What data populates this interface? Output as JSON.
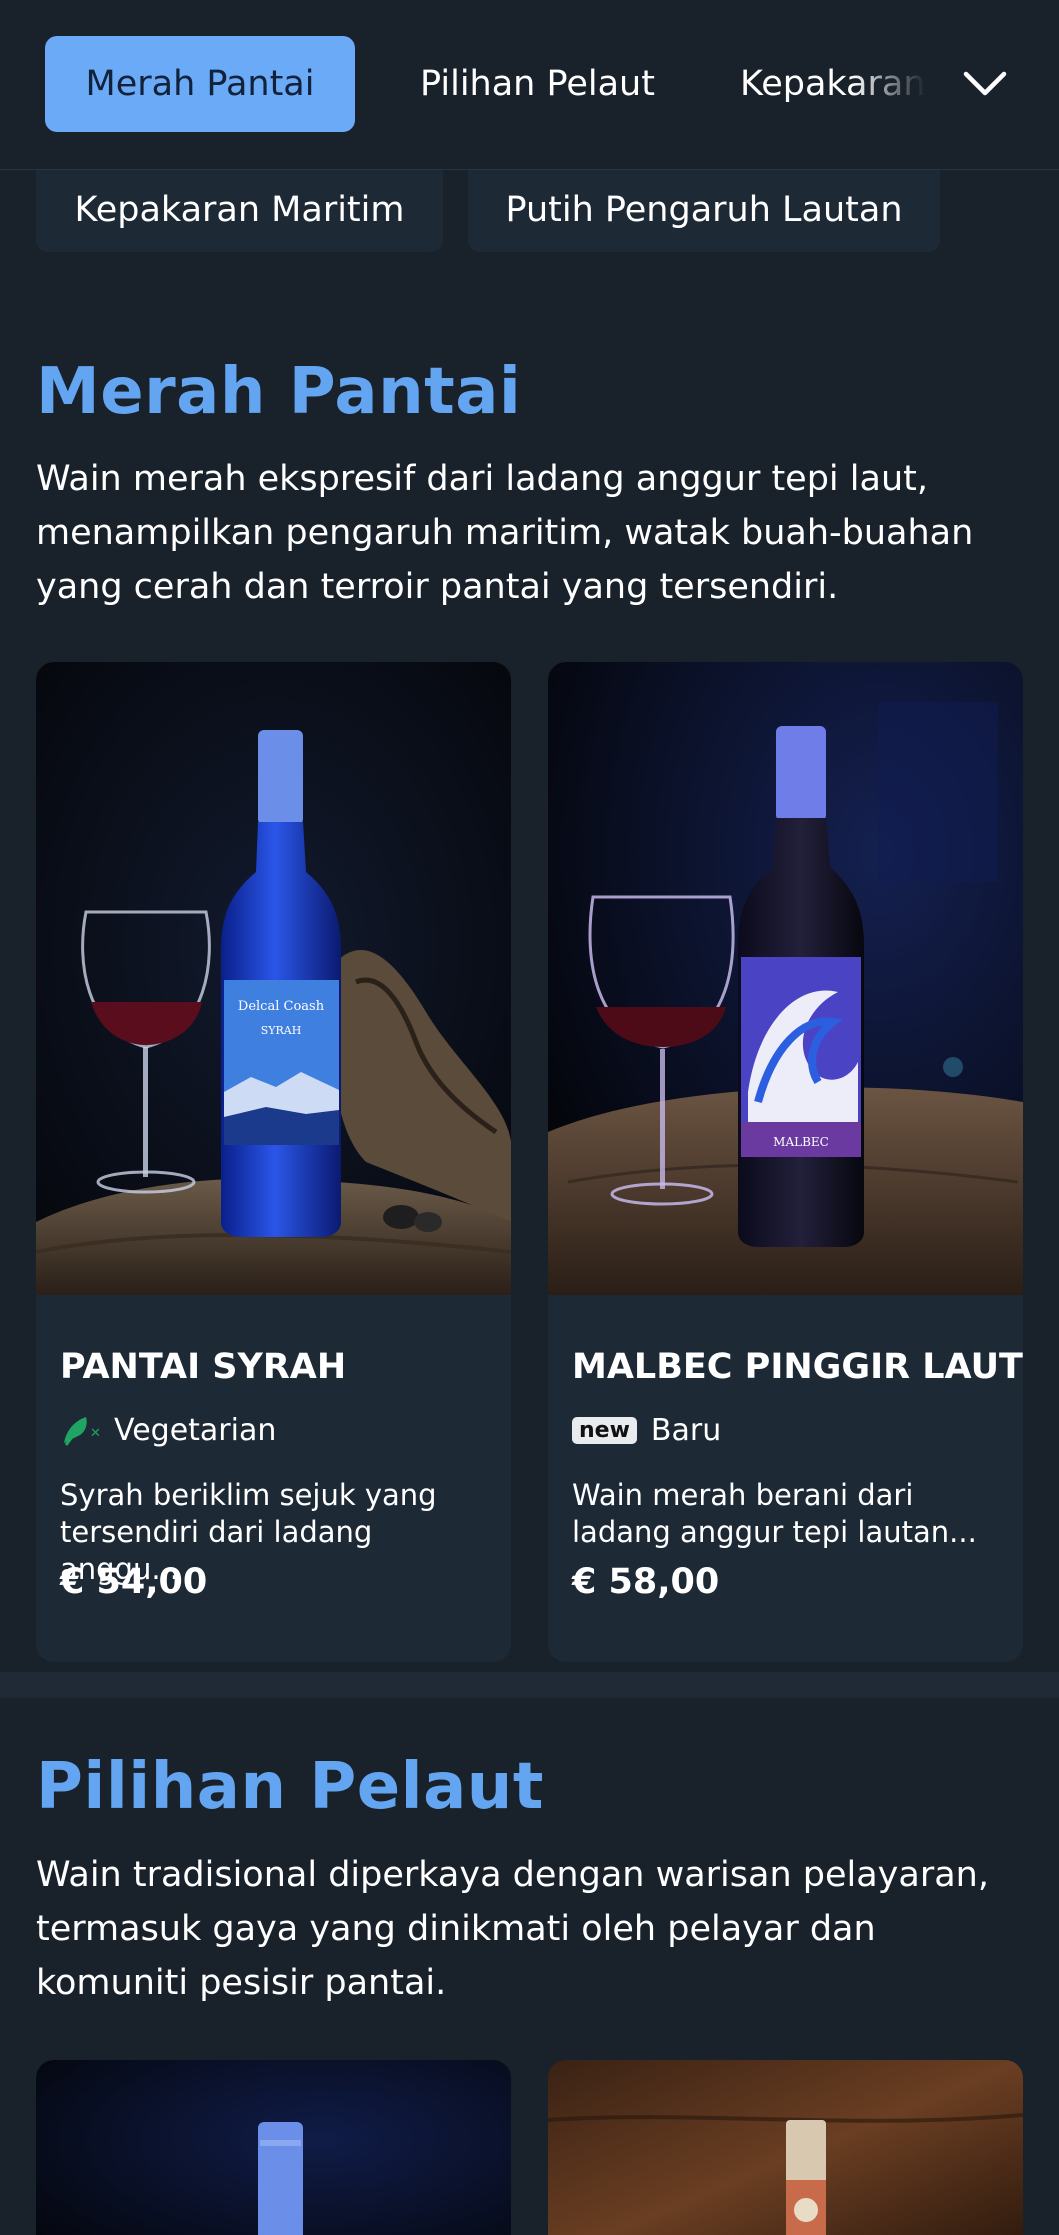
{
  "tabs": {
    "active": "Merah Pantai",
    "second": "Pilihan Pelaut",
    "third": "Kepakaran"
  },
  "chips": [
    "Kepakaran Maritim",
    "Putih Pengaruh Lautan"
  ],
  "sections": [
    {
      "title": "Merah Pantai",
      "description": "Wain merah ekspresif dari ladang anggur tepi laut, menampilkan pengaruh maritim, watak buah-buahan yang cerah dan terroir pantai yang tersendiri.",
      "products": [
        {
          "name": "PANTAI SYRAH",
          "badge": "Vegetarian",
          "description": "Syrah beriklim sejuk yang tersendiri dari ladang anggu...",
          "price": "€ 54,00",
          "label_line1": "Delcal Coash",
          "label_line2": "SYRAH"
        },
        {
          "name": "MALBEC PINGGIR LAUT",
          "badge_icon_text": "new",
          "badge": "Baru",
          "description": "Wain merah berani dari ladang anggur tepi lautan...",
          "price": "€ 58,00",
          "label_line1": "MALBEC"
        }
      ]
    },
    {
      "title": "Pilihan Pelaut",
      "description": "Wain tradisional diperkaya dengan warisan pelayaran, termasuk gaya yang dinikmati oleh pelayar dan komuniti pesisir pantai."
    }
  ],
  "colors": {
    "background": "#19212b",
    "card": "#1e2936",
    "accent": "#64a5f1",
    "active_tab": "#6aaaf7",
    "vegetarian_icon": "#1fa463"
  },
  "icons": {
    "tab_more": "chevron-down-icon",
    "vegetarian": "vegetarian-leaf-icon",
    "new": "new-badge-icon"
  }
}
